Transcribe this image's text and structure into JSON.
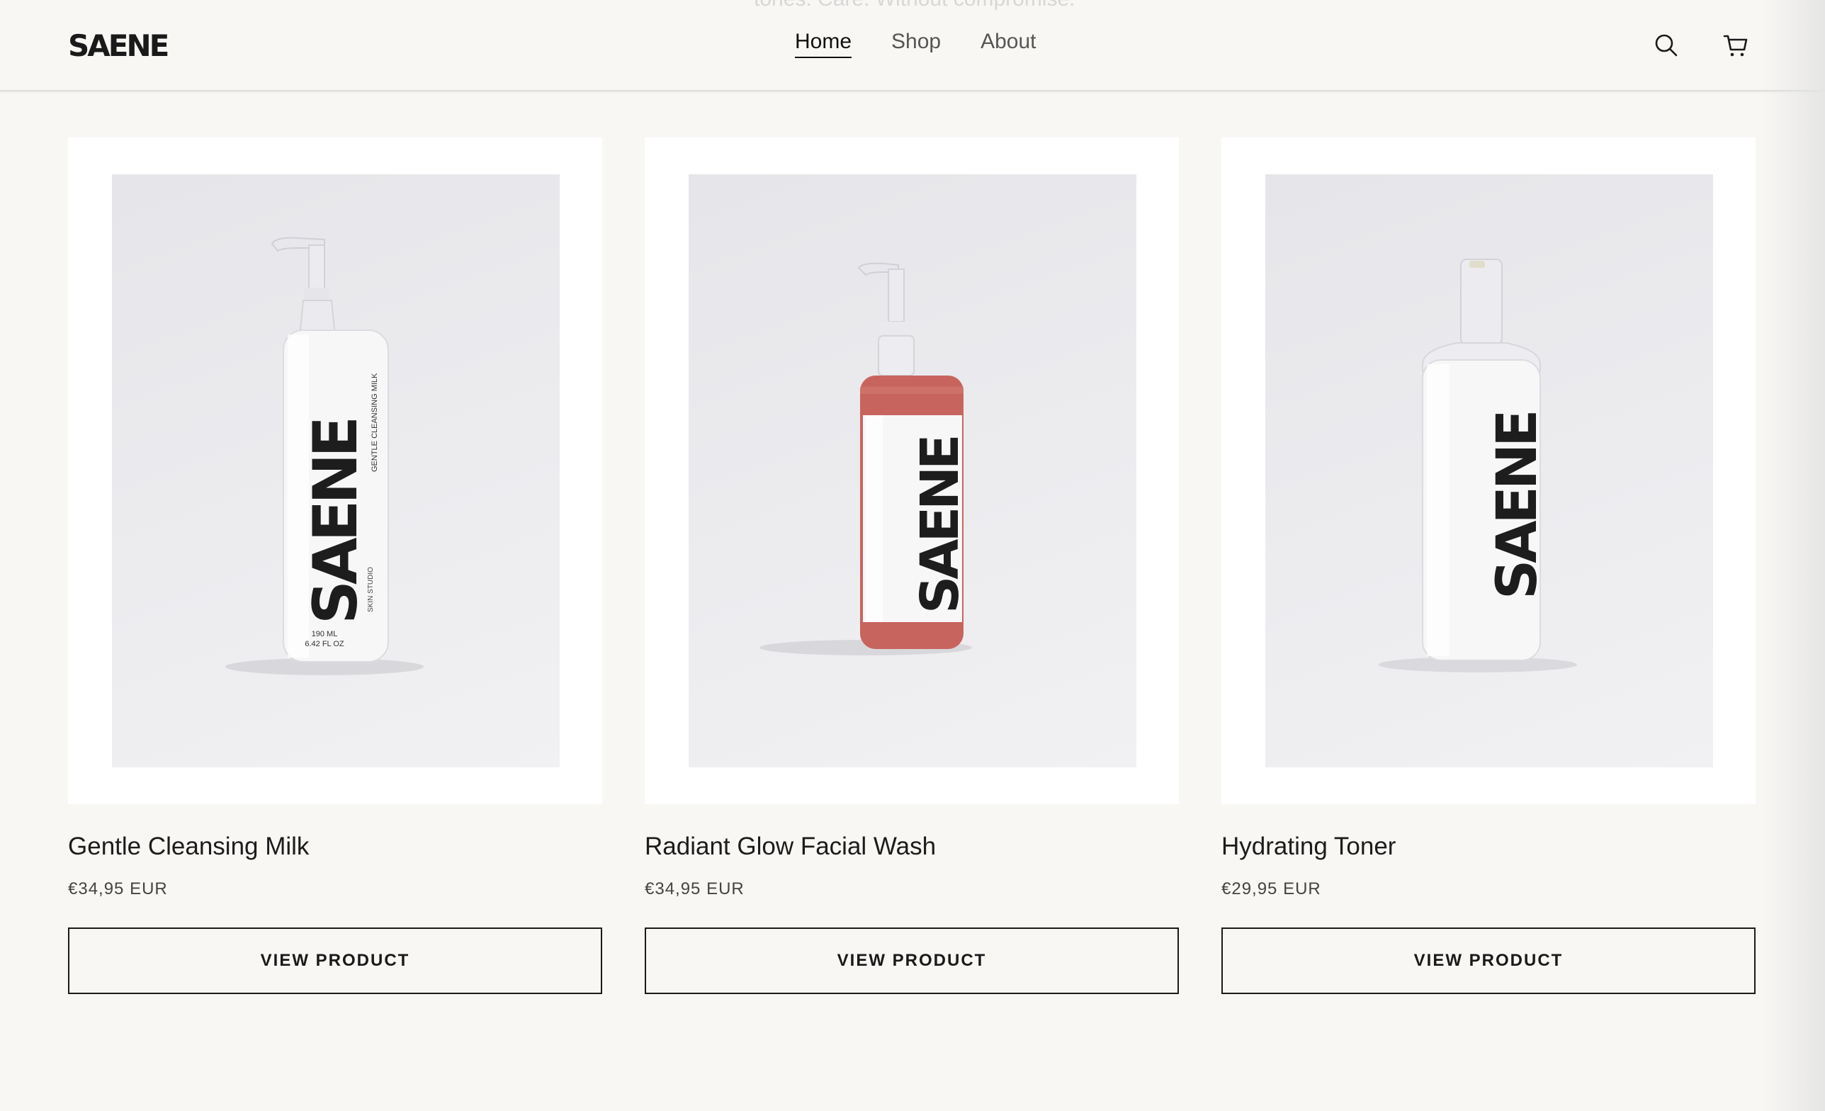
{
  "header": {
    "logo": "SAENE",
    "ghost_tagline": "tones. Care. Without compromise.",
    "nav": [
      {
        "label": "Home",
        "active": true
      },
      {
        "label": "Shop",
        "active": false
      },
      {
        "label": "About",
        "active": false
      }
    ],
    "icons": [
      "search-icon",
      "cart-icon"
    ]
  },
  "products": [
    {
      "name": "Gentle Cleansing Milk",
      "price": "€34,95 EUR",
      "button": "VIEW PRODUCT",
      "bottle_brand": "SAENE",
      "bottle_small": "GENTLE CLEANSING MILK",
      "bottle_studio": "SKIN STUDIO",
      "bottle_volume_1": "190 ML",
      "bottle_volume_2": "6.42 FL OZ"
    },
    {
      "name": "Radiant Glow Facial Wash",
      "price": "€34,95 EUR",
      "button": "VIEW PRODUCT",
      "bottle_brand": "SAENE"
    },
    {
      "name": "Hydrating Toner",
      "price": "€29,95 EUR",
      "button": "VIEW PRODUCT",
      "bottle_brand": "SAENE"
    }
  ],
  "colors": {
    "background": "#f8f7f4",
    "text": "#1a1a1a",
    "wash_gel": "#c8645e"
  }
}
